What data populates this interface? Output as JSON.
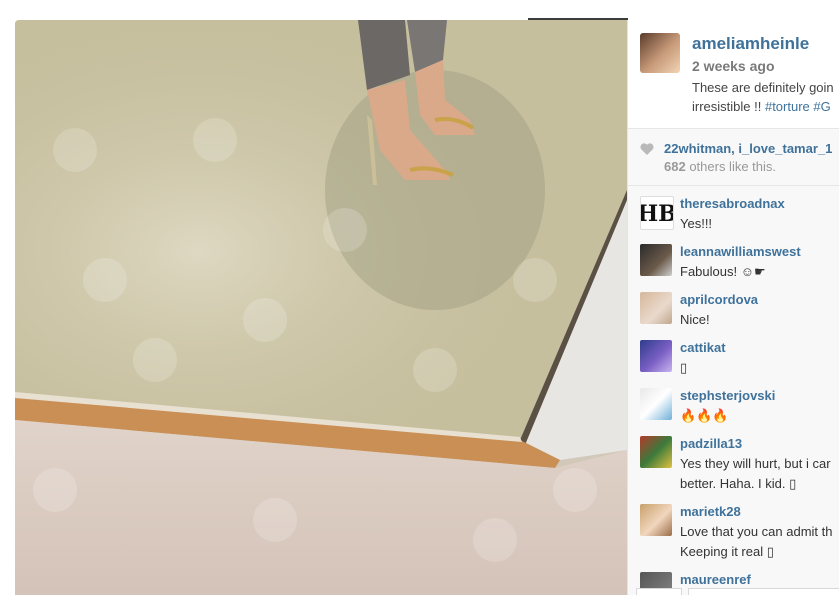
{
  "post": {
    "username": "ameliamheinle",
    "time_ago": "2 weeks ago",
    "caption_line1": "These are definitely goin",
    "caption_line2_prefix": "irresistible !! ",
    "caption_tag1": "#torture",
    "caption_tag2": " #G"
  },
  "likes": {
    "names": "22whitman, i_love_tamar_1",
    "count": "682",
    "suffix": " others like this."
  },
  "comments": [
    {
      "user": "theresabroadnax",
      "text": "Yes!!!"
    },
    {
      "user": "leannawilliamswest",
      "text": "Fabulous! ☺☛"
    },
    {
      "user": "aprilcordova",
      "text": "Nice!"
    },
    {
      "user": "cattikat",
      "text": "▯"
    },
    {
      "user": "stephsterjovski",
      "text": "🔥🔥🔥"
    },
    {
      "user": "padzilla13",
      "line1": "Yes they will hurt, but i car",
      "line2": "better. Haha. I kid. ▯"
    },
    {
      "user": "marietk28",
      "line1": "Love that you can admit th",
      "line2": "Keeping it real ▯"
    },
    {
      "user": "maureenref",
      "text": ""
    }
  ],
  "icons": {
    "heart": "heart-icon"
  },
  "colors": {
    "link": "#3f729b",
    "muted": "#999999",
    "panel_bg": "#f8f8f8"
  }
}
